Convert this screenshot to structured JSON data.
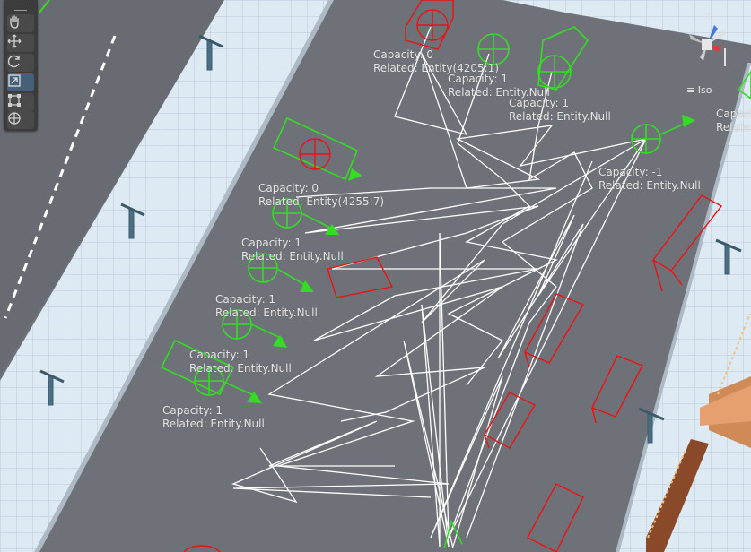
{
  "scene_labels": [
    {
      "capacity": "Capacity: 0",
      "related": "Related: Entity(4205:1)"
    },
    {
      "capacity": "Capacity: 1",
      "related": "Related: Entity.Null"
    },
    {
      "capacity": "Capacity: 1",
      "related": "Related: Entity.Null"
    },
    {
      "capacity": "Capacity: -1",
      "related": "Related: Entity.Null"
    },
    {
      "capacity": "Capacity: 0",
      "related": "Related: Entity(4255:7)"
    },
    {
      "capacity": "Capacity: 1",
      "related": "Related: Entity.Null"
    },
    {
      "capacity": "Capacity: 1",
      "related": "Related: Entity.Null"
    },
    {
      "capacity": "Capacity: 1",
      "related": "Related: Entity.Null"
    },
    {
      "capacity": "Capacity: 1",
      "related": "Related: Entity.Null"
    },
    {
      "capacity": "Capacity",
      "related": "Relate"
    }
  ],
  "scene_view": {
    "projection_label": "Iso",
    "tools": [
      "view-tool",
      "move-tool",
      "rotate-tool",
      "scale-tool",
      "rect-tool",
      "transform-tool"
    ],
    "active_tool": "scale-tool"
  },
  "colors": {
    "road": "#6e7278",
    "sidewalk": "#dde9f3",
    "gizmo_green": "#33dd22",
    "gizmo_red": "#ee1111",
    "path_white": "#ffffff",
    "toolbar_bg": "#3c3c3c",
    "active_tool_bg": "#46607c"
  }
}
